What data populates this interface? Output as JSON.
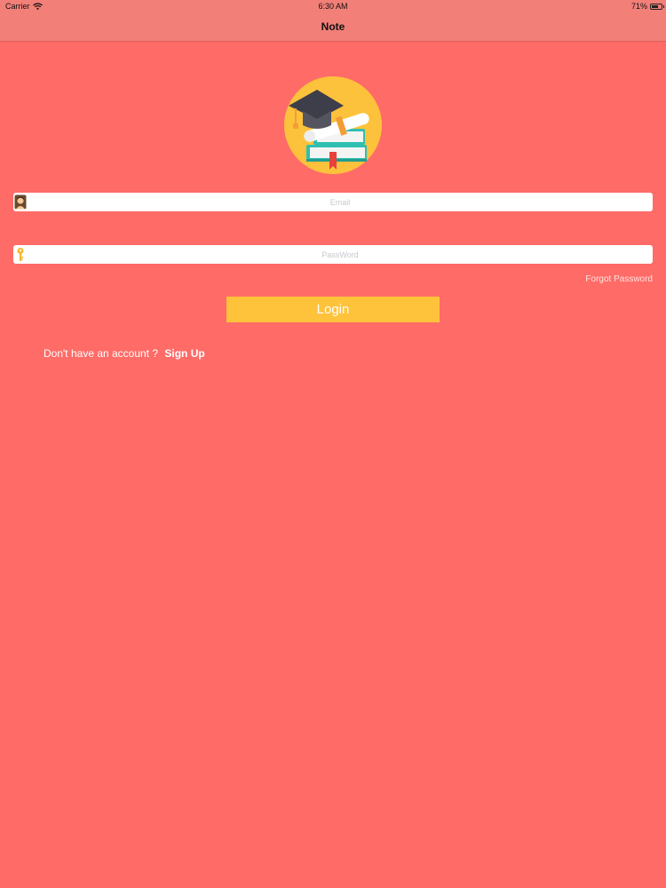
{
  "status_bar": {
    "carrier": "Carrier",
    "time": "6:30 AM",
    "battery": "71%",
    "battery_level": 0.71
  },
  "nav": {
    "title": "Note"
  },
  "logo": {
    "icon": "graduation-books-logo"
  },
  "login_form": {
    "email_placeholder": "Email",
    "email_icon": "user-avatar-icon",
    "password_placeholder": "PassWord",
    "password_icon": "key-icon",
    "forgot_password": "Forgot Password",
    "login_button": "Login",
    "signup_prompt": "Don't have an account ?",
    "signup_link": "Sign Up"
  },
  "colors": {
    "background": "#FF6B66",
    "nav_background": "#F27F78",
    "button": "#FFC23B",
    "logo_circle": "#FDC23C",
    "book_teal": "#2FBFB0"
  }
}
